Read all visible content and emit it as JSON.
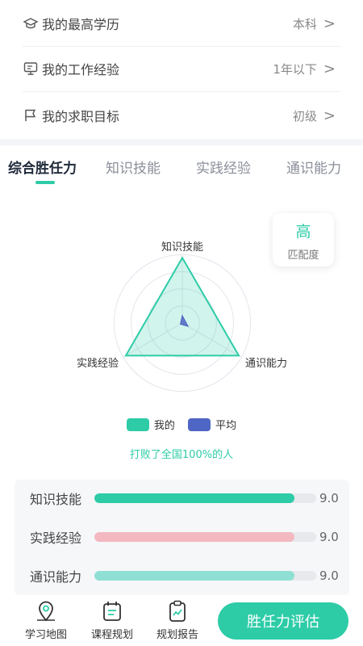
{
  "profile": {
    "rows": [
      {
        "label": "我的最高学历",
        "value": "本科",
        "icon": "graduation-cap-icon"
      },
      {
        "label": "我的工作经验",
        "value": "1年以下",
        "icon": "monitor-icon"
      },
      {
        "label": "我的求职目标",
        "value": "初级",
        "icon": "flag-icon"
      }
    ],
    "chevron": ">"
  },
  "tabs": [
    "综合胜任力",
    "知识技能",
    "实践经验",
    "通识能力"
  ],
  "active_tab": 0,
  "match": {
    "level": "高",
    "label": "匹配度"
  },
  "radar": {
    "axes": [
      "知识技能",
      "通识能力",
      "实践经验"
    ],
    "series": [
      {
        "name": "我的",
        "values": [
          9.0,
          9.0,
          9.0
        ],
        "color": "#2dcca7"
      },
      {
        "name": "平均",
        "values": [
          1.0,
          0.9,
          0.3
        ],
        "color": "#4f66c4"
      }
    ],
    "max": 10
  },
  "legend": {
    "mine": "我的",
    "avg": "平均"
  },
  "beat_text": "打败了全国100%的人",
  "scores": [
    {
      "label": "知识技能",
      "value": "9.0",
      "fraction": 0.9,
      "color": "#2dcca7"
    },
    {
      "label": "实践经验",
      "value": "9.0",
      "fraction": 0.9,
      "color": "#f3b8c0"
    },
    {
      "label": "通识能力",
      "value": "9.0",
      "fraction": 0.9,
      "color": "#8fe0d4"
    }
  ],
  "nav": [
    {
      "label": "学习地图",
      "icon": "map-pin-icon"
    },
    {
      "label": "课程规划",
      "icon": "calendar-icon"
    },
    {
      "label": "规划报告",
      "icon": "clipboard-icon"
    }
  ],
  "cta_label": "胜任力评估"
}
